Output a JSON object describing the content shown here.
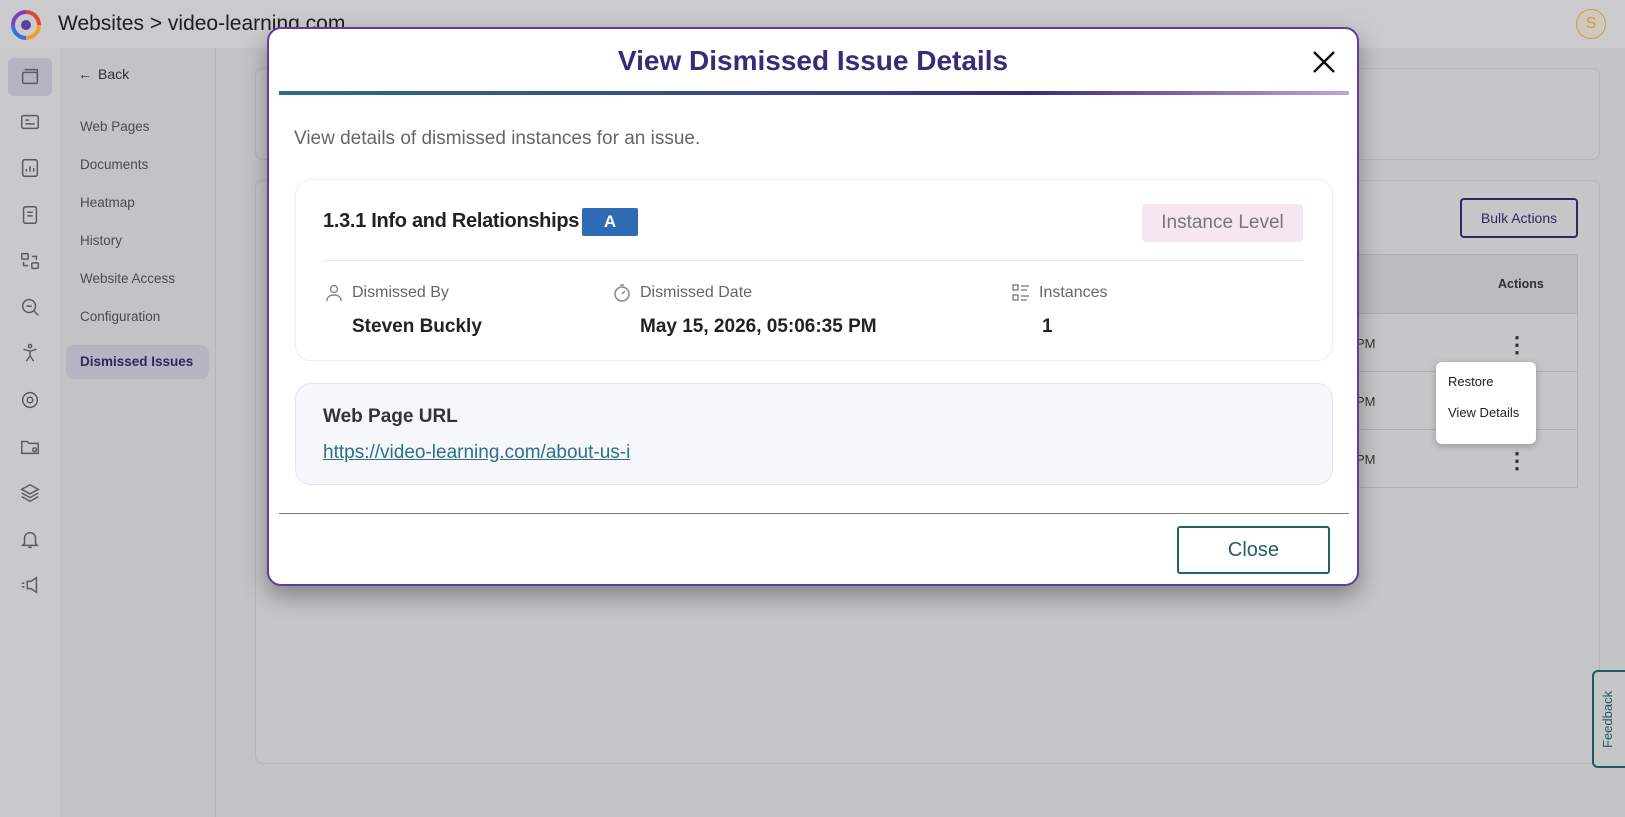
{
  "header": {
    "title": "Websites > video-learning.com",
    "user_initial": "S"
  },
  "rail": {
    "icons": [
      "websites-icon",
      "dashboard-icon",
      "reports-icon",
      "document-icon",
      "scan-icon",
      "search-icon",
      "accessibility-icon",
      "settings-icon",
      "folder-icon",
      "layers-icon",
      "bell-icon",
      "announcement-icon"
    ]
  },
  "subnav": {
    "back_label": "Back",
    "items": [
      "Web Pages",
      "Documents",
      "Heatmap",
      "History",
      "Website Access",
      "Configuration",
      "Dismissed Issues"
    ],
    "active_index": 6
  },
  "background": {
    "bulk_actions_label": "Bulk Actions",
    "actions_header": "Actions",
    "row_time_fragments": [
      "PM",
      "PM",
      "PM"
    ],
    "context_menu": [
      "Restore",
      "View Details"
    ],
    "feedback_label": "Feedback"
  },
  "modal": {
    "title": "View Dismissed Issue Details",
    "description": "View details of dismissed instances for an issue.",
    "issue": {
      "name": "1.3.1 Info and Relationships",
      "level": "A",
      "scope": "Instance Level",
      "dismissed_by_label": "Dismissed By",
      "dismissed_by_value": "Steven Buckly",
      "dismissed_date_label": "Dismissed Date",
      "dismissed_date_value": "May 15, 2026, 05:06:35 PM",
      "instances_label": "Instances",
      "instances_value": "1"
    },
    "url_section": {
      "label": "Web Page URL",
      "url": "https://video-learning.com/about-us-i"
    },
    "close_label": "Close"
  },
  "colors": {
    "brand_purple": "#3b2a78",
    "modal_border": "#5b3ea0",
    "level_badge": "#2f6bb3",
    "teal": "#22606c"
  }
}
